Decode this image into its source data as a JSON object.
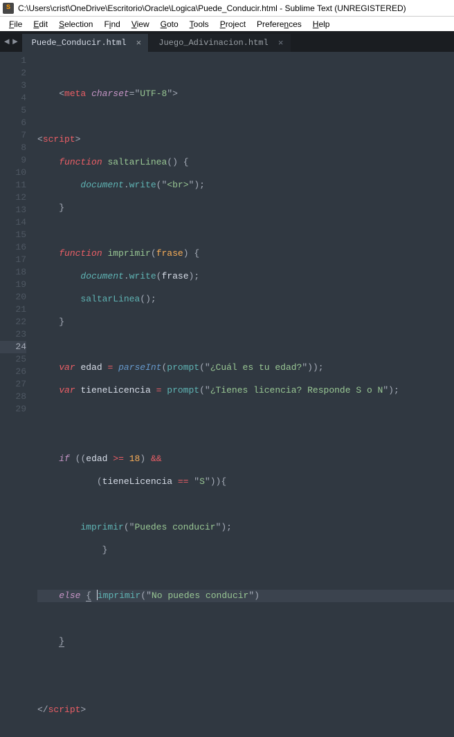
{
  "window": {
    "icon_letter": "S",
    "title": "C:\\Users\\crist\\OneDrive\\Escritorio\\Oracle\\Logica\\Puede_Conducir.html - Sublime Text (UNREGISTERED)"
  },
  "menu": {
    "file": "File",
    "edit": "Edit",
    "selection": "Selection",
    "find": "Find",
    "view": "View",
    "goto": "Goto",
    "tools": "Tools",
    "project": "Project",
    "preferences": "Preferences",
    "help": "Help"
  },
  "nav": {
    "back": "◄",
    "forward": "►"
  },
  "tabs": {
    "t0": {
      "label": "Puede_Conducir.html",
      "close": "×"
    },
    "t1": {
      "label": "Juego_Adivinacion.html",
      "close": "×"
    }
  },
  "gutter": {
    "l1": "1",
    "l2": "2",
    "l3": "3",
    "l4": "4",
    "l5": "5",
    "l6": "6",
    "l7": "7",
    "l8": "8",
    "l9": "9",
    "l10": "10",
    "l11": "11",
    "l12": "12",
    "l13": "13",
    "l14": "14",
    "l15": "15",
    "l16": "16",
    "l17": "17",
    "l18": "18",
    "l19": "19",
    "l20": "20",
    "l21": "21",
    "l22": "22",
    "l23": "23",
    "l24": "24",
    "l25": "25",
    "l26": "26",
    "l27": "27",
    "l28": "28",
    "l29": "29"
  },
  "tok": {
    "indent1": "    ",
    "indent2": "        ",
    "indent3": "            ",
    "indent4": "                ",
    "meta_open": "<",
    "meta": "meta",
    "sp": " ",
    "charset": "charset",
    "eq": "=",
    "quote": "\"",
    "utf8": "UTF-8",
    "gt": ">",
    "script_open": "<",
    "script": "script",
    "script_close": "</",
    "function": "function",
    "saltarLinea": "saltarLinea",
    "lparen": "(",
    "rparen": ")",
    "lbrace": "{",
    "rbrace": "}",
    "document": "document",
    "dot": ".",
    "write": "write",
    "br": "<br>",
    "semi": ";",
    "imprimir": "imprimir",
    "frase": "frase",
    "var": "var",
    "edad": "edad",
    "assign": " = ",
    "parseInt": "parseInt",
    "prompt": "prompt",
    "cual": "¿Cuál es tu edad?",
    "tieneLicencia": "tieneLicencia",
    "tienes": "¿Tienes licencia? Responde S o N",
    "if": "if",
    "gte": ">=",
    "n18": "18",
    "and": "&&",
    "eqeq": "==",
    "S": "S",
    "puedes": "Puedes conducir",
    "else": "else",
    "nopuedes": "No puedes conducir",
    "indent_lic": "           "
  },
  "active_line": 24
}
